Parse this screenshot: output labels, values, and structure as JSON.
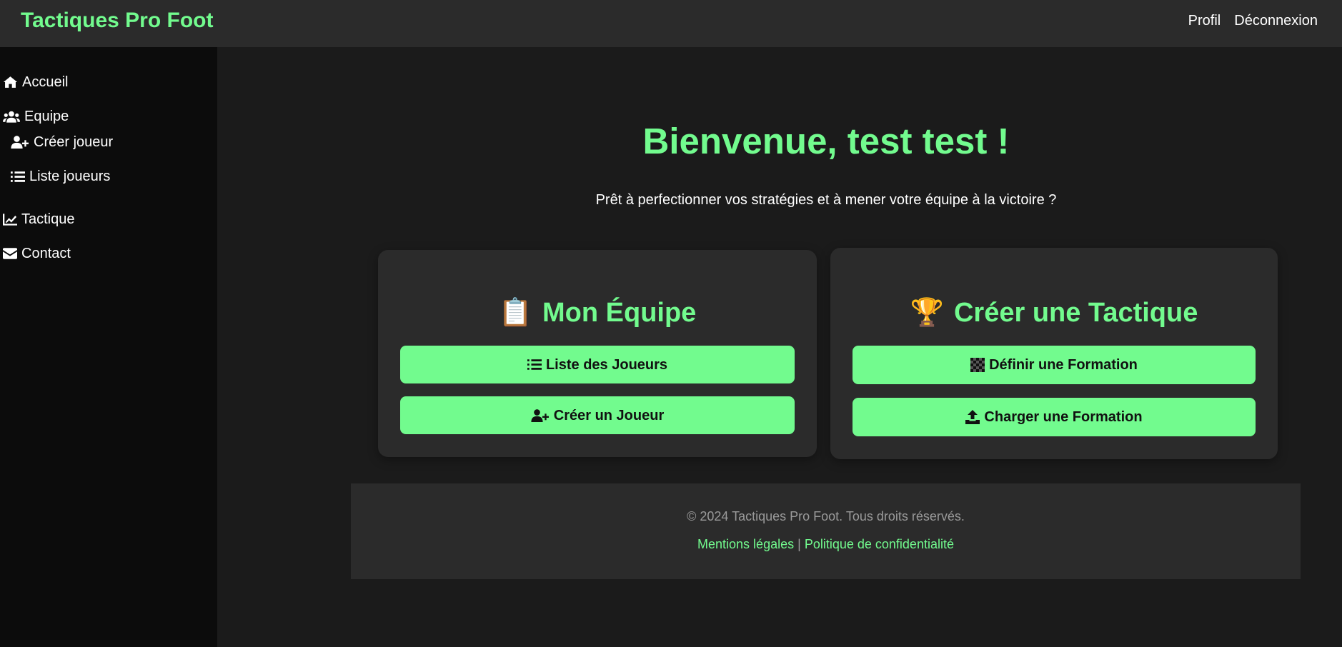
{
  "app": {
    "title": "Tactiques Pro Foot"
  },
  "topnav": {
    "profile": "Profil",
    "logout": "Déconnexion"
  },
  "sidebar": {
    "items": [
      {
        "label": "Accueil",
        "icon": "home-icon"
      },
      {
        "label": "Equipe",
        "icon": "users-icon"
      },
      {
        "label": "Créer joueur",
        "icon": "user-plus-icon"
      },
      {
        "label": "Liste joueurs",
        "icon": "list-icon"
      },
      {
        "label": "Tactique",
        "icon": "chart-line-icon"
      },
      {
        "label": "Contact",
        "icon": "envelope-icon"
      }
    ]
  },
  "welcome": {
    "title": "Bienvenue, test test !",
    "subtitle": "Prêt à perfectionner vos stratégies et à mener votre équipe à la victoire ?"
  },
  "cards": [
    {
      "emoji": "📋",
      "title": "Mon Équipe",
      "buttons": [
        {
          "label": "Liste des Joueurs",
          "icon": "list-icon"
        },
        {
          "label": "Créer un Joueur",
          "icon": "user-plus-icon"
        }
      ]
    },
    {
      "emoji": "🏆",
      "title": "Créer une Tactique",
      "buttons": [
        {
          "label": "Définir une Formation",
          "icon": "checkered-icon"
        },
        {
          "label": "Charger une Formation",
          "icon": "upload-icon"
        }
      ]
    }
  ],
  "footer": {
    "copyright": "© 2024 Tactiques Pro Foot. Tous droits réservés.",
    "legal": "Mentions légales",
    "separator": "|",
    "privacy": "Politique de confidentialité"
  },
  "colors": {
    "accent": "#72fb8e",
    "background": "#1b1b1b",
    "sidebar": "#0c0c0c",
    "panel": "#2b2b2b"
  }
}
